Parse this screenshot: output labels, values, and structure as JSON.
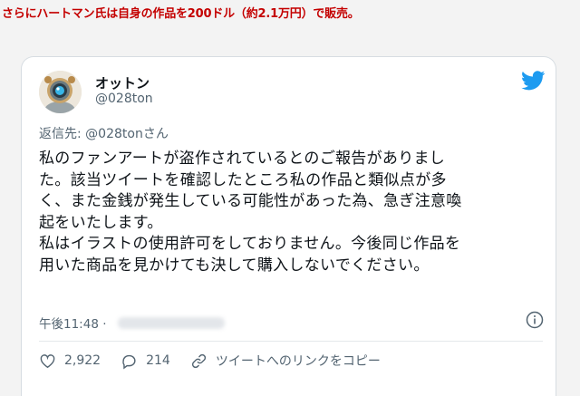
{
  "headline": "さらにハートマン氏は自身の作品を200ドル（約2.1万円）で販売。",
  "tweet": {
    "display_name": "オットン",
    "handle": "@028ton",
    "reply_prefix": "返信先: ",
    "reply_handle": "@028tonさん",
    "text_lines": [
      "私のファンアートが盗作されているとのご報告がありまし",
      "た。該当ツイートを確認したところ私の作品と類似点が多",
      "く、また金銭が発生している可能性があった為、急ぎ注意喚",
      "起をいたします。",
      "私はイラストの使用許可をしておりません。今後同じ作品を",
      "用いた商品を見かけても決して購入しないでください。"
    ],
    "time": "午後11:48 ·",
    "likes": "2,922",
    "replies": "214",
    "share_label": "ツイートへのリンクをコピー"
  },
  "colors": {
    "headline": "#c40000",
    "twitter_blue": "#1d9bf0",
    "secondary_text": "#536471",
    "primary_text": "#0f1419"
  },
  "icons": [
    "twitter-bird-icon",
    "info-icon",
    "heart-icon",
    "reply-bubble-icon",
    "copy-link-icon"
  ]
}
